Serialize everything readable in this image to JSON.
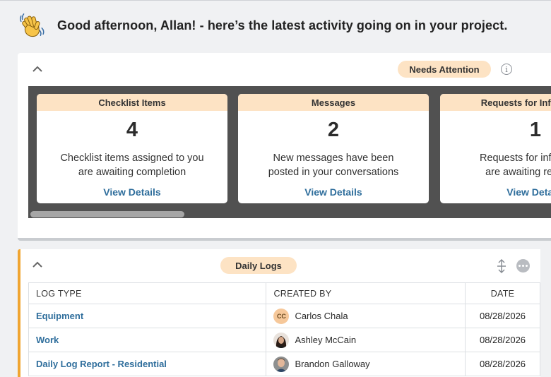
{
  "greeting": {
    "icon": "waving-hand-icon",
    "text": "Good afternoon, Allan! - here’s the latest activity going on in your project."
  },
  "needs_attention": {
    "badge": "Needs Attention",
    "cards": [
      {
        "title": "Checklist Items",
        "count": "4",
        "desc_line1": "Checklist items assigned to you",
        "desc_line2": "are awaiting completion",
        "link": "View Details"
      },
      {
        "title": "Messages",
        "count": "2",
        "desc_line1": "New messages have been",
        "desc_line2": "posted in your conversations",
        "link": "View Details"
      },
      {
        "title": "Requests for Information",
        "count": "1",
        "desc_line1": "Requests for information",
        "desc_line2": "are awaiting response",
        "link": "View Details"
      }
    ]
  },
  "daily_logs": {
    "badge": "Daily Logs",
    "columns": {
      "type": "LOG TYPE",
      "created_by": "CREATED BY",
      "date": "DATE"
    },
    "rows": [
      {
        "type": "Equipment",
        "created_by": "Carlos Chala",
        "initials": "CC",
        "date": "08/28/2026"
      },
      {
        "type": "Work",
        "created_by": "Ashley McCain",
        "date": "08/28/2026"
      },
      {
        "type": "Daily Log Report - Residential",
        "created_by": "Brandon Galloway",
        "date": "08/28/2026"
      }
    ]
  },
  "colors": {
    "accent_orange": "#f0a531",
    "pill_bg": "#fde3c4",
    "link_blue": "#2f6e9c",
    "cards_bg": "#515151"
  }
}
